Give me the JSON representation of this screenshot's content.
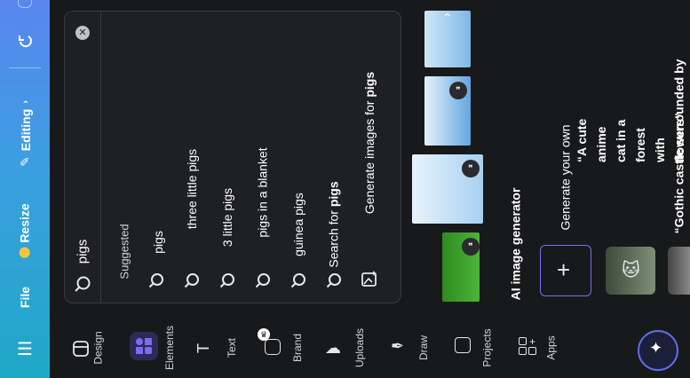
{
  "topbar": {
    "menu_icon": "hamburger-icon",
    "file_label": "File",
    "resize_label": "Resize",
    "editing_label": "Editing",
    "undo_icon": "undo-icon",
    "colors": {
      "gradient_start": "#1fa8c6",
      "gradient_end": "#5a86ee"
    }
  },
  "sidenav": {
    "items": [
      {
        "label": "Design",
        "icon": "layout-icon"
      },
      {
        "label": "Elements",
        "icon": "shapes-icon"
      },
      {
        "label": "Text",
        "icon": "text-icon"
      },
      {
        "label": "Brand",
        "icon": "brand-icon"
      },
      {
        "label": "Uploads",
        "icon": "cloud-upload-icon"
      },
      {
        "label": "Draw",
        "icon": "pen-icon"
      },
      {
        "label": "Projects",
        "icon": "folder-icon"
      },
      {
        "label": "Apps",
        "icon": "apps-icon"
      }
    ]
  },
  "search": {
    "value": "pigs",
    "suggested_heading": "Suggested",
    "suggestions": [
      "pigs",
      "three little pigs",
      "3 little pigs",
      "pigs in a blanket",
      "guinea pigs"
    ],
    "search_for_prefix": "Search for ",
    "search_for_term": "pigs",
    "generate_prefix": "Generate images for ",
    "generate_term": "pigs"
  },
  "ai_generator": {
    "heading": "AI image generator",
    "generate_own_label": "Generate your own",
    "prompt_1": "“A cute anime cat in a forest with flowers”",
    "prompt_2": "“Gothic castle surrounded by"
  },
  "magic_icon": "sparkle-icon"
}
